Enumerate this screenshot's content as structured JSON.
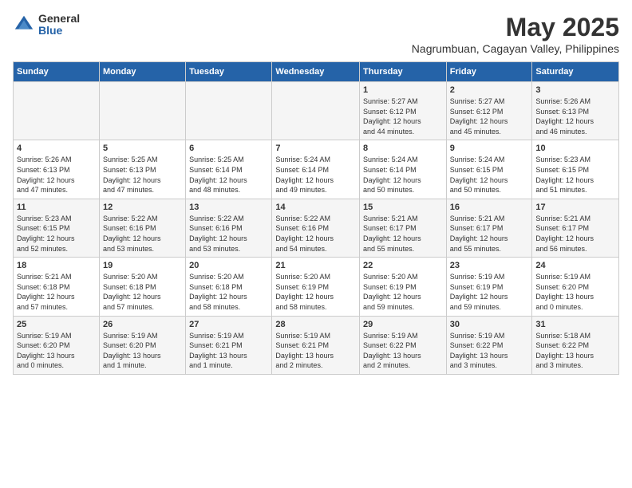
{
  "logo": {
    "general": "General",
    "blue": "Blue"
  },
  "header": {
    "title": "May 2025",
    "subtitle": "Nagrumbuan, Cagayan Valley, Philippines"
  },
  "weekdays": [
    "Sunday",
    "Monday",
    "Tuesday",
    "Wednesday",
    "Thursday",
    "Friday",
    "Saturday"
  ],
  "weeks": [
    [
      {
        "day": "",
        "details": ""
      },
      {
        "day": "",
        "details": ""
      },
      {
        "day": "",
        "details": ""
      },
      {
        "day": "",
        "details": ""
      },
      {
        "day": "1",
        "details": "Sunrise: 5:27 AM\nSunset: 6:12 PM\nDaylight: 12 hours\nand 44 minutes."
      },
      {
        "day": "2",
        "details": "Sunrise: 5:27 AM\nSunset: 6:12 PM\nDaylight: 12 hours\nand 45 minutes."
      },
      {
        "day": "3",
        "details": "Sunrise: 5:26 AM\nSunset: 6:13 PM\nDaylight: 12 hours\nand 46 minutes."
      }
    ],
    [
      {
        "day": "4",
        "details": "Sunrise: 5:26 AM\nSunset: 6:13 PM\nDaylight: 12 hours\nand 47 minutes."
      },
      {
        "day": "5",
        "details": "Sunrise: 5:25 AM\nSunset: 6:13 PM\nDaylight: 12 hours\nand 47 minutes."
      },
      {
        "day": "6",
        "details": "Sunrise: 5:25 AM\nSunset: 6:14 PM\nDaylight: 12 hours\nand 48 minutes."
      },
      {
        "day": "7",
        "details": "Sunrise: 5:24 AM\nSunset: 6:14 PM\nDaylight: 12 hours\nand 49 minutes."
      },
      {
        "day": "8",
        "details": "Sunrise: 5:24 AM\nSunset: 6:14 PM\nDaylight: 12 hours\nand 50 minutes."
      },
      {
        "day": "9",
        "details": "Sunrise: 5:24 AM\nSunset: 6:15 PM\nDaylight: 12 hours\nand 50 minutes."
      },
      {
        "day": "10",
        "details": "Sunrise: 5:23 AM\nSunset: 6:15 PM\nDaylight: 12 hours\nand 51 minutes."
      }
    ],
    [
      {
        "day": "11",
        "details": "Sunrise: 5:23 AM\nSunset: 6:15 PM\nDaylight: 12 hours\nand 52 minutes."
      },
      {
        "day": "12",
        "details": "Sunrise: 5:22 AM\nSunset: 6:16 PM\nDaylight: 12 hours\nand 53 minutes."
      },
      {
        "day": "13",
        "details": "Sunrise: 5:22 AM\nSunset: 6:16 PM\nDaylight: 12 hours\nand 53 minutes."
      },
      {
        "day": "14",
        "details": "Sunrise: 5:22 AM\nSunset: 6:16 PM\nDaylight: 12 hours\nand 54 minutes."
      },
      {
        "day": "15",
        "details": "Sunrise: 5:21 AM\nSunset: 6:17 PM\nDaylight: 12 hours\nand 55 minutes."
      },
      {
        "day": "16",
        "details": "Sunrise: 5:21 AM\nSunset: 6:17 PM\nDaylight: 12 hours\nand 55 minutes."
      },
      {
        "day": "17",
        "details": "Sunrise: 5:21 AM\nSunset: 6:17 PM\nDaylight: 12 hours\nand 56 minutes."
      }
    ],
    [
      {
        "day": "18",
        "details": "Sunrise: 5:21 AM\nSunset: 6:18 PM\nDaylight: 12 hours\nand 57 minutes."
      },
      {
        "day": "19",
        "details": "Sunrise: 5:20 AM\nSunset: 6:18 PM\nDaylight: 12 hours\nand 57 minutes."
      },
      {
        "day": "20",
        "details": "Sunrise: 5:20 AM\nSunset: 6:18 PM\nDaylight: 12 hours\nand 58 minutes."
      },
      {
        "day": "21",
        "details": "Sunrise: 5:20 AM\nSunset: 6:19 PM\nDaylight: 12 hours\nand 58 minutes."
      },
      {
        "day": "22",
        "details": "Sunrise: 5:20 AM\nSunset: 6:19 PM\nDaylight: 12 hours\nand 59 minutes."
      },
      {
        "day": "23",
        "details": "Sunrise: 5:19 AM\nSunset: 6:19 PM\nDaylight: 12 hours\nand 59 minutes."
      },
      {
        "day": "24",
        "details": "Sunrise: 5:19 AM\nSunset: 6:20 PM\nDaylight: 13 hours\nand 0 minutes."
      }
    ],
    [
      {
        "day": "25",
        "details": "Sunrise: 5:19 AM\nSunset: 6:20 PM\nDaylight: 13 hours\nand 0 minutes."
      },
      {
        "day": "26",
        "details": "Sunrise: 5:19 AM\nSunset: 6:20 PM\nDaylight: 13 hours\nand 1 minute."
      },
      {
        "day": "27",
        "details": "Sunrise: 5:19 AM\nSunset: 6:21 PM\nDaylight: 13 hours\nand 1 minute."
      },
      {
        "day": "28",
        "details": "Sunrise: 5:19 AM\nSunset: 6:21 PM\nDaylight: 13 hours\nand 2 minutes."
      },
      {
        "day": "29",
        "details": "Sunrise: 5:19 AM\nSunset: 6:22 PM\nDaylight: 13 hours\nand 2 minutes."
      },
      {
        "day": "30",
        "details": "Sunrise: 5:19 AM\nSunset: 6:22 PM\nDaylight: 13 hours\nand 3 minutes."
      },
      {
        "day": "31",
        "details": "Sunrise: 5:18 AM\nSunset: 6:22 PM\nDaylight: 13 hours\nand 3 minutes."
      }
    ]
  ]
}
